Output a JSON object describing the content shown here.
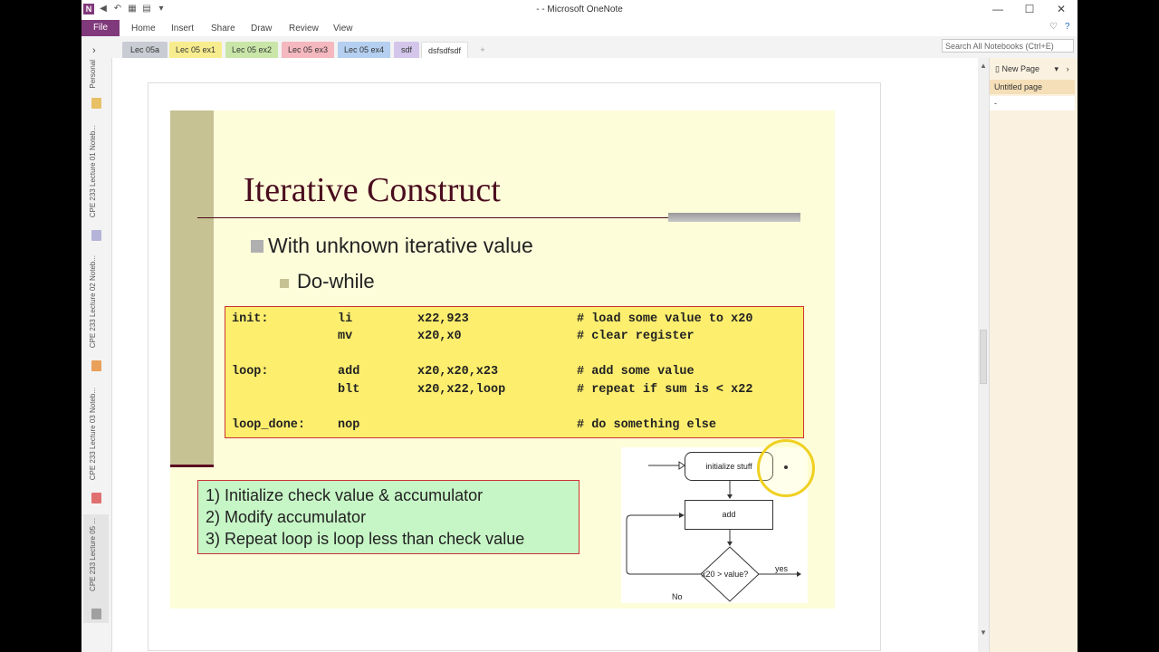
{
  "window": {
    "title": "- - Microsoft OneNote",
    "minimize": "—",
    "maximize": "☐",
    "close": "✕",
    "logo": "N"
  },
  "ribbon": {
    "file": "File",
    "tabs": [
      "Home",
      "Insert",
      "Share",
      "Draw",
      "Review",
      "View"
    ]
  },
  "sections": {
    "tabs": [
      {
        "label": "Lec 05a",
        "color": "#c9ccd3"
      },
      {
        "label": "Lec 05 ex1",
        "color": "#f8ed8e"
      },
      {
        "label": "Lec 05 ex2",
        "color": "#c9e6a8"
      },
      {
        "label": "Lec 05 ex3",
        "color": "#f5b8bf"
      },
      {
        "label": "Lec 05 ex4",
        "color": "#b4cff0"
      },
      {
        "label": "sdf",
        "color": "#d3c6ea"
      },
      {
        "label": "dsfsdfsdf",
        "color": "#ffffff"
      }
    ],
    "add": "+",
    "search_placeholder": "Search All Notebooks (Ctrl+E)"
  },
  "notebooks": {
    "expand": "›",
    "items": [
      {
        "label": "Personal",
        "color": "#e8c066"
      },
      {
        "label": "CPE 233 Lecture 01 Noteb...",
        "color": "#b4b4d8"
      },
      {
        "label": "CPE 233 Lecture 02 Noteb...",
        "color": "#e8a05a"
      },
      {
        "label": "CPE 233 Lecture 03 Noteb...",
        "color": "#e07070"
      },
      {
        "label": "CPE 233 Lecture 05 ...",
        "color": "#a0a0a0"
      }
    ]
  },
  "slide": {
    "title": "Iterative Construct",
    "bullet1": "With unknown iterative value",
    "bullet2": "Do-while",
    "code": [
      {
        "label": "init:",
        "op": "li",
        "args": "x22,923",
        "comment": "# load some value to x20"
      },
      {
        "label": "",
        "op": "mv",
        "args": "x20,x0",
        "comment": "# clear register"
      },
      {
        "label": "loop:",
        "op": "add",
        "args": "x20,x20,x23",
        "comment": "# add some value"
      },
      {
        "label": "",
        "op": "blt",
        "args": "x20,x22,loop",
        "comment": "# repeat if sum is < x22"
      },
      {
        "label": "loop_done:",
        "op": "nop",
        "args": "",
        "comment": "# do something else"
      }
    ],
    "steps": [
      "1)  Initialize check value & accumulator",
      "2)  Modify accumulator",
      "3)  Repeat loop is loop less than check value"
    ],
    "flow": {
      "init": "initialize stuff",
      "add": "add",
      "cond": "x20 > value?",
      "yes": "yes",
      "no": "No"
    }
  },
  "pages": {
    "new_page": "New Page",
    "items": [
      "Untitled page",
      "-"
    ]
  }
}
